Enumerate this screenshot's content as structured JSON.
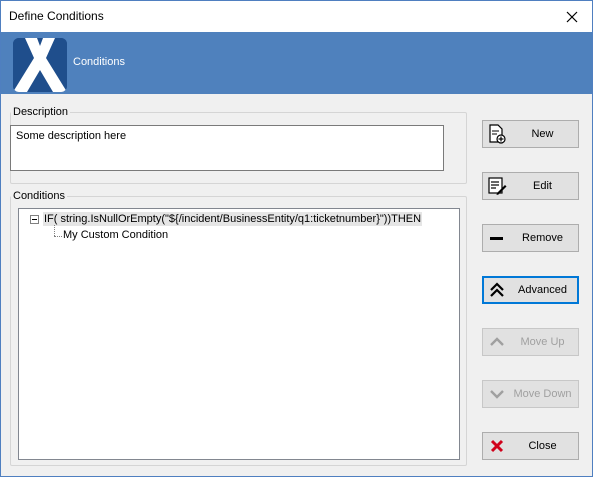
{
  "window": {
    "title": "Define Conditions"
  },
  "banner": {
    "title": "Conditions"
  },
  "description": {
    "group_label": "Description",
    "value": "Some description here"
  },
  "conditions": {
    "group_label": "Conditions",
    "tree": {
      "root_label": "IF( string.IsNullOrEmpty(\"${/incident/BusinessEntity/q1:ticketnumber}\"))THEN",
      "children": [
        {
          "label": "My Custom Condition"
        }
      ]
    }
  },
  "buttons": {
    "new": "New",
    "edit": "Edit",
    "remove": "Remove",
    "advanced": "Advanced",
    "move_up": "Move Up",
    "move_down": "Move Down",
    "close": "Close"
  },
  "colors": {
    "banner": "#4f81bd",
    "logo_bg": "#1f4e8c",
    "focus_border": "#0078d7",
    "close_icon": "#d0021b"
  }
}
